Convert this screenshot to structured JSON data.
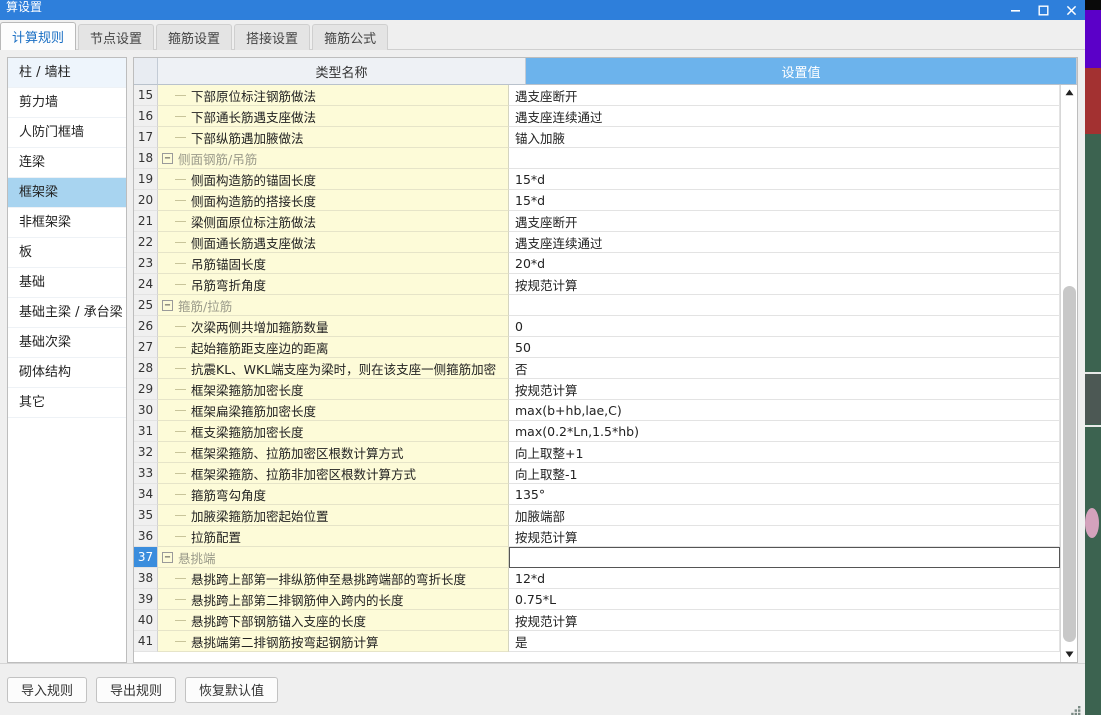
{
  "window": {
    "title": "算设置",
    "controls": [
      {
        "name": "minimize",
        "glyph": "—"
      },
      {
        "name": "maximize",
        "glyph": "▢"
      },
      {
        "name": "close",
        "glyph": "✕"
      }
    ]
  },
  "tabs": [
    {
      "label": "计算规则",
      "active": true
    },
    {
      "label": "节点设置",
      "active": false
    },
    {
      "label": "箍筋设置",
      "active": false
    },
    {
      "label": "搭接设置",
      "active": false
    },
    {
      "label": "箍筋公式",
      "active": false
    }
  ],
  "sidebar": {
    "items": [
      {
        "label": "柱 / 墙柱",
        "state": "tinted"
      },
      {
        "label": "剪力墙",
        "state": "normal"
      },
      {
        "label": "人防门框墙",
        "state": "normal"
      },
      {
        "label": "连梁",
        "state": "normal"
      },
      {
        "label": "框架梁",
        "state": "selected"
      },
      {
        "label": "非框架梁",
        "state": "normal"
      },
      {
        "label": "板",
        "state": "normal"
      },
      {
        "label": "基础",
        "state": "normal"
      },
      {
        "label": "基础主梁 / 承台梁",
        "state": "normal"
      },
      {
        "label": "基础次梁",
        "state": "normal"
      },
      {
        "label": "砌体结构",
        "state": "normal"
      },
      {
        "label": "其它",
        "state": "normal"
      }
    ]
  },
  "grid": {
    "headers": {
      "num": "",
      "name": "类型名称",
      "value": "设置值"
    },
    "rows": [
      {
        "num": "15",
        "name": "下部原位标注钢筋做法",
        "value": "遇支座断开",
        "kind": "child",
        "selected": false
      },
      {
        "num": "16",
        "name": "下部通长筋遇支座做法",
        "value": "遇支座连续通过",
        "kind": "child",
        "selected": false
      },
      {
        "num": "17",
        "name": "下部纵筋遇加腋做法",
        "value": "锚入加腋",
        "kind": "child",
        "selected": false
      },
      {
        "num": "18",
        "name": "侧面钢筋/吊筋",
        "value": "",
        "kind": "group",
        "selected": false
      },
      {
        "num": "19",
        "name": "侧面构造筋的锚固长度",
        "value": "15*d",
        "kind": "child",
        "selected": false
      },
      {
        "num": "20",
        "name": "侧面构造筋的搭接长度",
        "value": "15*d",
        "kind": "child",
        "selected": false
      },
      {
        "num": "21",
        "name": "梁侧面原位标注筋做法",
        "value": "遇支座断开",
        "kind": "child",
        "selected": false
      },
      {
        "num": "22",
        "name": "侧面通长筋遇支座做法",
        "value": "遇支座连续通过",
        "kind": "child",
        "selected": false
      },
      {
        "num": "23",
        "name": "吊筋锚固长度",
        "value": "20*d",
        "kind": "child",
        "selected": false
      },
      {
        "num": "24",
        "name": "吊筋弯折角度",
        "value": "按规范计算",
        "kind": "child",
        "selected": false
      },
      {
        "num": "25",
        "name": "箍筋/拉筋",
        "value": "",
        "kind": "group",
        "selected": false
      },
      {
        "num": "26",
        "name": "次梁两侧共增加箍筋数量",
        "value": "0",
        "kind": "child",
        "selected": false
      },
      {
        "num": "27",
        "name": "起始箍筋距支座边的距离",
        "value": "50",
        "kind": "child",
        "selected": false
      },
      {
        "num": "28",
        "name": "抗震KL、WKL端支座为梁时，则在该支座一侧箍筋加密",
        "value": "否",
        "kind": "child",
        "selected": false
      },
      {
        "num": "29",
        "name": "框架梁箍筋加密长度",
        "value": "按规范计算",
        "kind": "child",
        "selected": false
      },
      {
        "num": "30",
        "name": "框架扁梁箍筋加密长度",
        "value": "max(b+hb,lae,C)",
        "kind": "child",
        "selected": false
      },
      {
        "num": "31",
        "name": "框支梁箍筋加密长度",
        "value": "max(0.2*Ln,1.5*hb)",
        "kind": "child",
        "selected": false
      },
      {
        "num": "32",
        "name": "框架梁箍筋、拉筋加密区根数计算方式",
        "value": "向上取整+1",
        "kind": "child",
        "selected": false
      },
      {
        "num": "33",
        "name": "框架梁箍筋、拉筋非加密区根数计算方式",
        "value": "向上取整-1",
        "kind": "child",
        "selected": false
      },
      {
        "num": "34",
        "name": "箍筋弯勾角度",
        "value": "135°",
        "kind": "child",
        "selected": false
      },
      {
        "num": "35",
        "name": "加腋梁箍筋加密起始位置",
        "value": "加腋端部",
        "kind": "child",
        "selected": false
      },
      {
        "num": "36",
        "name": "拉筋配置",
        "value": "按规范计算",
        "kind": "child",
        "selected": false
      },
      {
        "num": "37",
        "name": "悬挑端",
        "value": "",
        "kind": "group",
        "selected": true
      },
      {
        "num": "38",
        "name": "悬挑跨上部第一排纵筋伸至悬挑跨端部的弯折长度",
        "value": "12*d",
        "kind": "child",
        "selected": false
      },
      {
        "num": "39",
        "name": "悬挑跨上部第二排钢筋伸入跨内的长度",
        "value": "0.75*L",
        "kind": "child",
        "selected": false
      },
      {
        "num": "40",
        "name": "悬挑跨下部钢筋锚入支座的长度",
        "value": "按规范计算",
        "kind": "child",
        "selected": false
      },
      {
        "num": "41",
        "name": "悬挑端第二排钢筋按弯起钢筋计算",
        "value": "是",
        "kind": "child",
        "selected": false
      }
    ],
    "expander_collapse_glyph": "−",
    "scrollbar": {
      "up_arrow": "▲",
      "down_arrow": "▼"
    }
  },
  "footer": {
    "buttons": [
      {
        "label": "导入规则"
      },
      {
        "label": "导出规则"
      },
      {
        "label": "恢复默认值"
      }
    ]
  },
  "colors": {
    "titlebar": "#2e7fdb",
    "value_header": "#6cb3ec",
    "selected_row_num": "#3a8ddd",
    "sidebar_selected": "#a8d4f0",
    "name_cell": "#fdfbd8"
  }
}
